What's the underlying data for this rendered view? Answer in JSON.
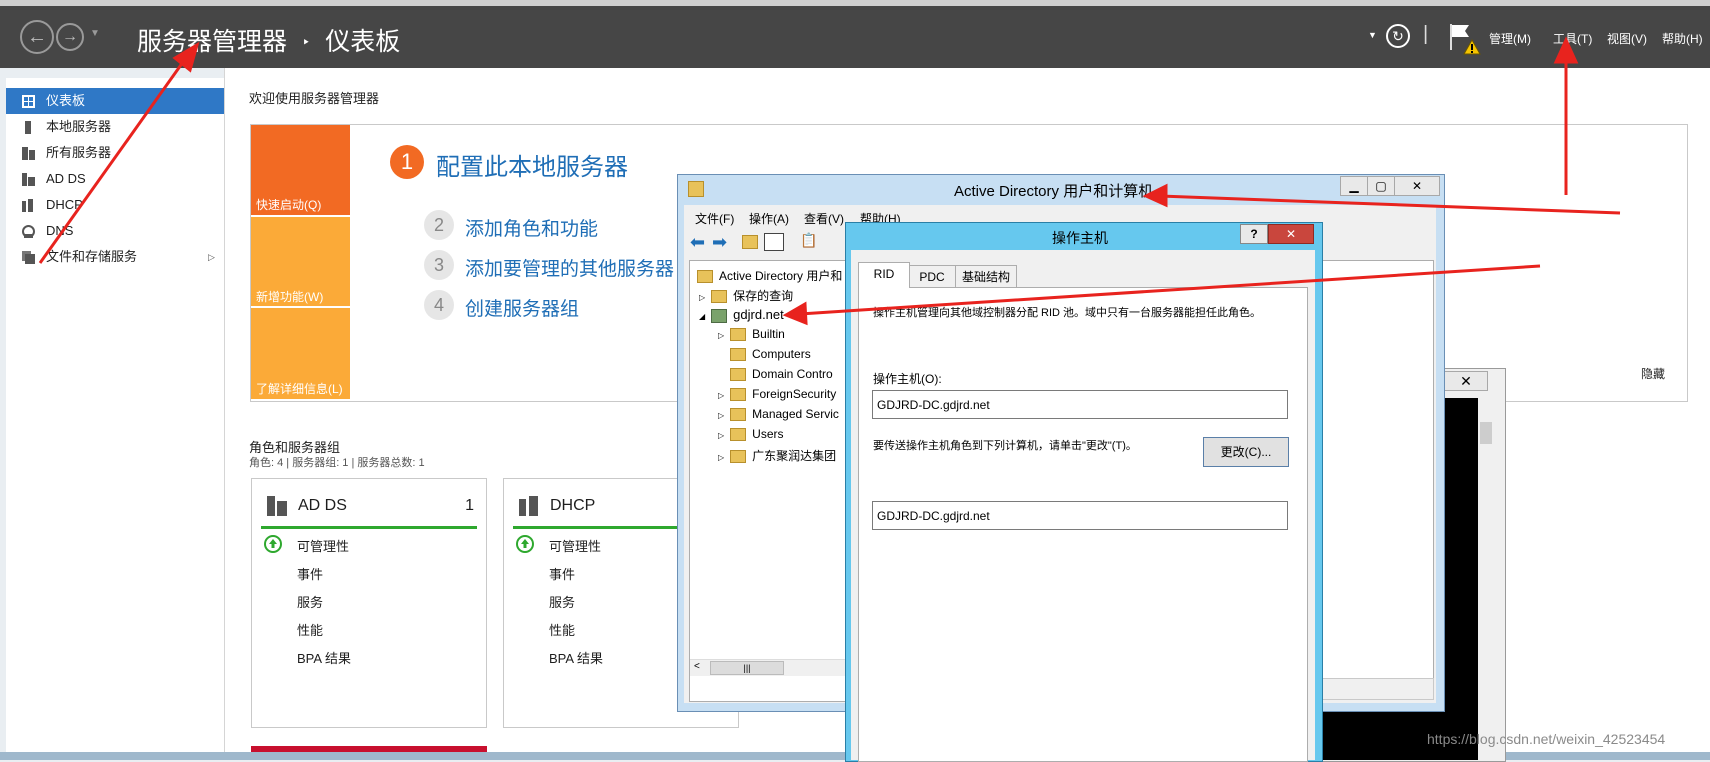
{
  "window_title": "服务器管理器",
  "header": {
    "app_name": "服务器管理器",
    "separator": "‣",
    "page": "仪表板",
    "menus": [
      "管理(M)",
      "工具(T)",
      "视图(V)",
      "帮助(H)"
    ],
    "divider": "|"
  },
  "sidebar": {
    "items": [
      {
        "label": "仪表板",
        "active": true,
        "icon": "dashboard-icon"
      },
      {
        "label": "本地服务器",
        "icon": "server-icon"
      },
      {
        "label": "所有服务器",
        "icon": "servers-icon"
      },
      {
        "label": "AD DS",
        "icon": "ad-ds-icon"
      },
      {
        "label": "DHCP",
        "icon": "dhcp-icon"
      },
      {
        "label": "DNS",
        "icon": "dns-icon"
      },
      {
        "label": "文件和存储服务",
        "icon": "storage-icon"
      }
    ]
  },
  "welcome": {
    "title": "欢迎使用服务器管理器",
    "tiles": [
      "快速启动(Q)",
      "新增功能(W)",
      "了解详细信息(L)"
    ],
    "step1": {
      "num": "1",
      "label": "配置此本地服务器"
    },
    "steps": [
      {
        "num": "2",
        "label": "添加角色和功能"
      },
      {
        "num": "3",
        "label": "添加要管理的其他服务器"
      },
      {
        "num": "4",
        "label": "创建服务器组"
      }
    ],
    "hide": "隐藏"
  },
  "roles": {
    "title": "角色和服务器组",
    "subtitle": "角色: 4 | 服务器组: 1 | 服务器总数: 1",
    "cards": [
      {
        "title": "AD DS",
        "count": "1",
        "rows": [
          "可管理性",
          "事件",
          "服务",
          "性能",
          "BPA 结果"
        ]
      },
      {
        "title": "DHCP",
        "count": "",
        "rows": [
          "可管理性",
          "事件",
          "服务",
          "性能",
          "BPA 结果"
        ]
      }
    ]
  },
  "aduc": {
    "title": "Active Directory 用户和计算机",
    "menus": [
      "文件(F)",
      "操作(A)",
      "查看(V)",
      "帮助(H)"
    ],
    "tree": [
      {
        "label": "Active Directory 用户和"
      },
      {
        "label": "保存的查询"
      },
      {
        "label": "gdjrd.net"
      },
      {
        "label": "Builtin"
      },
      {
        "label": "Computers"
      },
      {
        "label": "Domain Contro"
      },
      {
        "label": "ForeignSecurity"
      },
      {
        "label": "Managed Servic"
      },
      {
        "label": "Users"
      },
      {
        "label": "广东聚润达集团"
      }
    ],
    "scroll_thumb": "|||"
  },
  "opmaster": {
    "title": "操作主机",
    "help": "?",
    "close": "✕",
    "tabs": [
      "RID",
      "PDC",
      "基础结构"
    ],
    "description": "操作主机管理向其他域控制器分配 RID 池。域中只有一台服务器能担任此角色。",
    "owner_label": "操作主机(O):",
    "owner_value": "GDJRD-DC.gdjrd.net",
    "transfer_text": "要传送操作主机角色到下列计算机，请单击\"更改\"(T)。",
    "change_button": "更改(C)...",
    "target_value": "GDJRD-DC.gdjrd.net"
  },
  "watermark": "https://blog.csdn.net/weixin_42523454",
  "colors": {
    "accent": "#2f78c6",
    "orange": "#f26a23",
    "arrow": "#e8231e"
  }
}
